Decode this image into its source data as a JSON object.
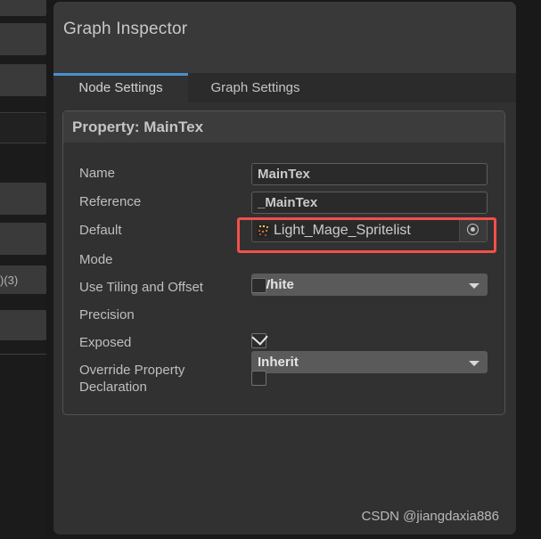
{
  "window": {
    "title": "Graph Inspector"
  },
  "tabs": [
    {
      "label": "Node Settings",
      "active": true
    },
    {
      "label": "Graph Settings",
      "active": false
    }
  ],
  "property_panel": {
    "header": "Property: MainTex",
    "rows": [
      {
        "label": "Name",
        "type": "text",
        "value": "MainTex"
      },
      {
        "label": "Reference",
        "type": "text",
        "value": "_MainTex"
      },
      {
        "label": "Default",
        "type": "object",
        "value": "Light_Mage_Spritelist"
      },
      {
        "label": "Mode",
        "type": "dropdown",
        "value": "White"
      },
      {
        "label": "Use Tiling and Offset",
        "type": "checkbox",
        "value": false
      },
      {
        "label": "Precision",
        "type": "dropdown",
        "value": "Inherit"
      },
      {
        "label": "Exposed",
        "type": "checkbox",
        "value": true
      },
      {
        "label": "Override Property\nDeclaration",
        "type": "checkbox",
        "value": false
      }
    ]
  },
  "background_list": {
    "partial_label": ")(3)"
  },
  "annotation": {
    "color": "#f2504b",
    "targets": "Default"
  },
  "watermark": {
    "text": "CSDN @jiangdaxia886"
  },
  "icons": {
    "object_picker": "target-circle-icon",
    "dropdown_arrow": "chevron-down-icon",
    "checkmark": "check-icon",
    "texture_thumb": "texture-thumbnail-icon"
  }
}
